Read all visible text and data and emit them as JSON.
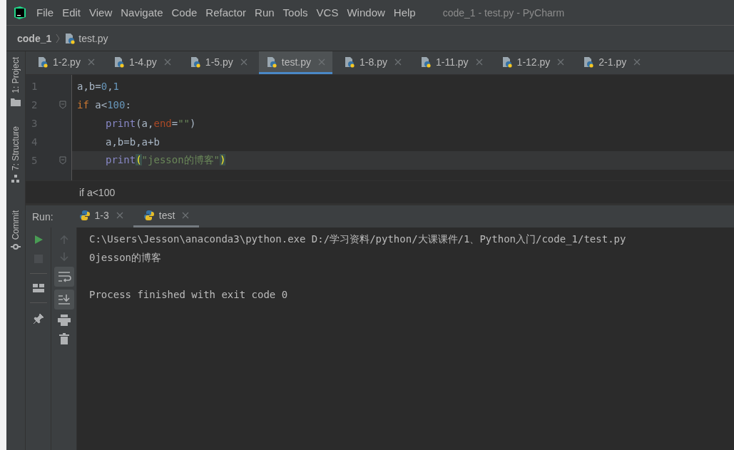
{
  "menu": [
    "File",
    "Edit",
    "View",
    "Navigate",
    "Code",
    "Refactor",
    "Run",
    "Tools",
    "VCS",
    "Window",
    "Help"
  ],
  "window": {
    "title": "code_1 - test.py - PyCharm"
  },
  "breadcrumb": [
    "code_1",
    "test.py"
  ],
  "side_tools": [
    {
      "label": "1: Project",
      "kind": "folder"
    },
    {
      "label": "7: Structure",
      "kind": "structure"
    },
    {
      "label": "Commit",
      "kind": "commit"
    }
  ],
  "tabs": [
    {
      "label": "1-2.py",
      "selected": false
    },
    {
      "label": "1-4.py",
      "selected": false
    },
    {
      "label": "1-5.py",
      "selected": false
    },
    {
      "label": "test.py",
      "selected": true
    },
    {
      "label": "1-8.py",
      "selected": false
    },
    {
      "label": "1-11.py",
      "selected": false
    },
    {
      "label": "1-12.py",
      "selected": false
    },
    {
      "label": "2-1.py",
      "selected": false
    }
  ],
  "code": [
    {
      "number": "1",
      "indented": false,
      "current": false,
      "fold": false,
      "tokens": [
        {
          "text": "a,b=",
          "kind": "plain"
        },
        {
          "text": "0",
          "kind": "number"
        },
        {
          "text": ",",
          "kind": "plain"
        },
        {
          "text": "1",
          "kind": "number"
        }
      ]
    },
    {
      "number": "2",
      "indented": false,
      "current": false,
      "fold": true,
      "tokens": [
        {
          "text": "if ",
          "kind": "keyword"
        },
        {
          "text": "a<",
          "kind": "plain"
        },
        {
          "text": "100",
          "kind": "number"
        },
        {
          "text": ":",
          "kind": "plain"
        }
      ]
    },
    {
      "number": "3",
      "indented": true,
      "current": false,
      "fold": false,
      "tokens": [
        {
          "text": "print",
          "kind": "builtin"
        },
        {
          "text": "(a,",
          "kind": "plain"
        },
        {
          "text": "end",
          "kind": "param"
        },
        {
          "text": "=",
          "kind": "plain"
        },
        {
          "text": "\"\"",
          "kind": "string"
        },
        {
          "text": ")",
          "kind": "plain"
        }
      ]
    },
    {
      "number": "4",
      "indented": true,
      "current": false,
      "fold": false,
      "tokens": [
        {
          "text": "a,b=b,a+b",
          "kind": "plain"
        }
      ]
    },
    {
      "number": "5",
      "indented": true,
      "current": true,
      "fold": true,
      "tokens": [
        {
          "text": "print",
          "kind": "builtin"
        },
        {
          "text": "(",
          "kind": "brace"
        },
        {
          "text": "\"jesson的博客\"",
          "kind": "string"
        },
        {
          "text": ")",
          "kind": "brace"
        }
      ]
    }
  ],
  "editor_breadcrumb": "if a<100",
  "run": {
    "label": "Run:",
    "tabs": [
      {
        "label": "1-3",
        "selected": false
      },
      {
        "label": "test",
        "selected": true
      }
    ],
    "console": [
      [
        "C:\\Users\\Jesson\\anaconda3\\python.exe D:/学习资料/python/大课课件/1、Python入门/code_1/test.py",
        "0jesson的博客"
      ],
      [
        "Process finished with exit code 0"
      ]
    ]
  }
}
